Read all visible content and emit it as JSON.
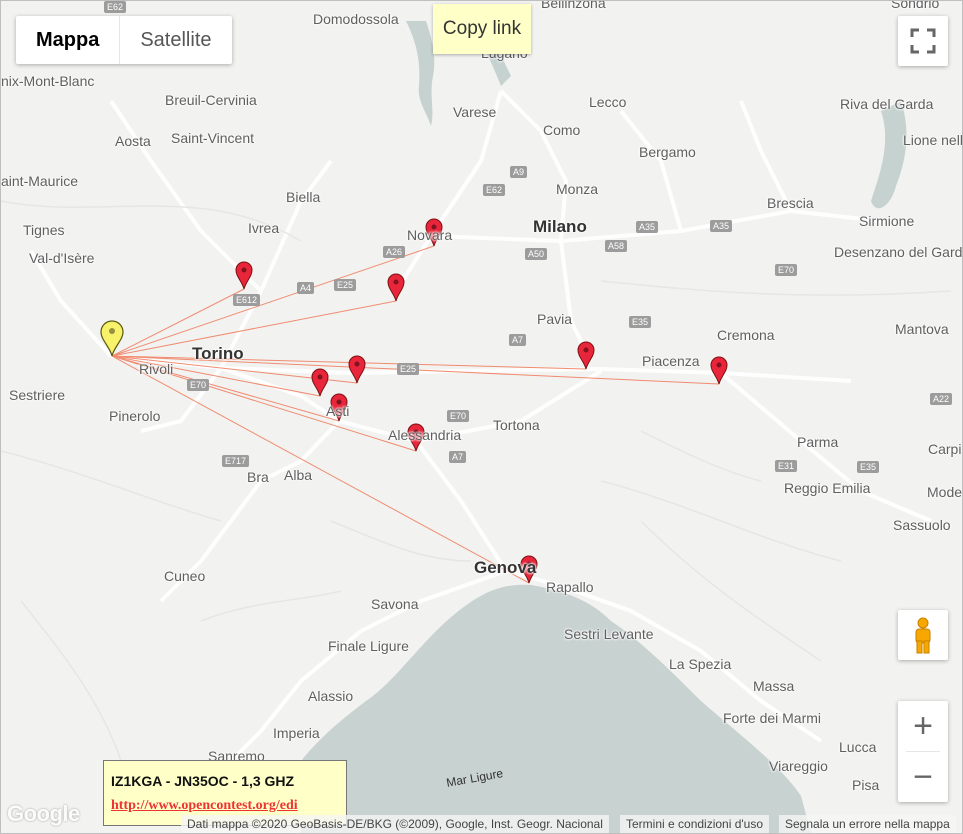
{
  "map_type": {
    "options": [
      "Mappa",
      "Satellite"
    ],
    "selected": "Mappa"
  },
  "copy_link_label": "Copy link",
  "places": [
    {
      "name": "Domodossola"
    },
    {
      "name": "Bellinzona"
    },
    {
      "name": "Lugano"
    },
    {
      "name": "Sondrio"
    },
    {
      "name": "nix-Mont-Blanc"
    },
    {
      "name": "Breuil-Cervinia"
    },
    {
      "name": "Aosta"
    },
    {
      "name": "Saint-Vincent"
    },
    {
      "name": "aint-Maurice"
    },
    {
      "name": "Tignes"
    },
    {
      "name": "Val-d'Isère"
    },
    {
      "name": "Biella"
    },
    {
      "name": "Ivrea"
    },
    {
      "name": "Varese"
    },
    {
      "name": "Como"
    },
    {
      "name": "Lecco"
    },
    {
      "name": "Bergamo"
    },
    {
      "name": "Monza"
    },
    {
      "name": "Milano"
    },
    {
      "name": "Brescia"
    },
    {
      "name": "Riva del Garda"
    },
    {
      "name": "Lione nella Sul Garda"
    },
    {
      "name": "Sirmione"
    },
    {
      "name": "Desenzano del Garda"
    },
    {
      "name": "Novara"
    },
    {
      "name": "Pavia"
    },
    {
      "name": "Cremona"
    },
    {
      "name": "Mantova"
    },
    {
      "name": "Torino"
    },
    {
      "name": "Rivoli"
    },
    {
      "name": "Sestriere"
    },
    {
      "name": "Pinerolo"
    },
    {
      "name": "Asti"
    },
    {
      "name": "Alessandria"
    },
    {
      "name": "Tortona"
    },
    {
      "name": "Piacenza"
    },
    {
      "name": "Parma"
    },
    {
      "name": "Reggio Emilia"
    },
    {
      "name": "Modena"
    },
    {
      "name": "Carpi"
    },
    {
      "name": "Sassuolo"
    },
    {
      "name": "Bra"
    },
    {
      "name": "Alba"
    },
    {
      "name": "Cuneo"
    },
    {
      "name": "Genova"
    },
    {
      "name": "Rapallo"
    },
    {
      "name": "Savona"
    },
    {
      "name": "Sestri Levante"
    },
    {
      "name": "Finale Ligure"
    },
    {
      "name": "La Spezia"
    },
    {
      "name": "Massa"
    },
    {
      "name": "Forte dei Marmi"
    },
    {
      "name": "Alassio"
    },
    {
      "name": "Imperia"
    },
    {
      "name": "Sanremo"
    },
    {
      "name": "Lucca"
    },
    {
      "name": "Viareggio"
    },
    {
      "name": "Pisa"
    },
    {
      "name": "Mar Ligure"
    }
  ],
  "highways": [
    "E62",
    "A26",
    "A9",
    "E62",
    "A50",
    "A58",
    "A35",
    "A35",
    "E70",
    "E612",
    "A4",
    "E25",
    "A7",
    "E35",
    "E25",
    "E70",
    "A7",
    "E70",
    "E717",
    "A22",
    "E31",
    "E35"
  ],
  "markers": {
    "home": {
      "color": "#f7f26a",
      "lat": 45.06,
      "lon": 7.45
    },
    "contacts": [
      {
        "color": "#e8253a"
      },
      {
        "color": "#e8253a"
      },
      {
        "color": "#e8253a"
      },
      {
        "color": "#e8253a"
      },
      {
        "color": "#e8253a"
      },
      {
        "color": "#e8253a"
      },
      {
        "color": "#e8253a"
      },
      {
        "color": "#e8253a"
      },
      {
        "color": "#e8253a"
      },
      {
        "color": "#e8253a"
      }
    ]
  },
  "route_color": "#f07a5a",
  "info_window": {
    "title": "IZ1KGA - JN35OC - 1,3 GHZ",
    "link": "http://www.opencontest.org/edi"
  },
  "attribution": {
    "data": "Dati mappa ©2020 GeoBasis-DE/BKG (©2009), Google, Inst. Geogr. Nacional",
    "terms": "Termini e condizioni d'uso",
    "report": "Segnala un errore nella mappa"
  },
  "logo": "Google",
  "controls": {
    "zoom_in": "+",
    "zoom_out": "−"
  },
  "colors": {
    "sea": "#c8d2d1",
    "land": "#f2f2f0",
    "lake": "#c6d2d0",
    "road": "#ffffff"
  }
}
